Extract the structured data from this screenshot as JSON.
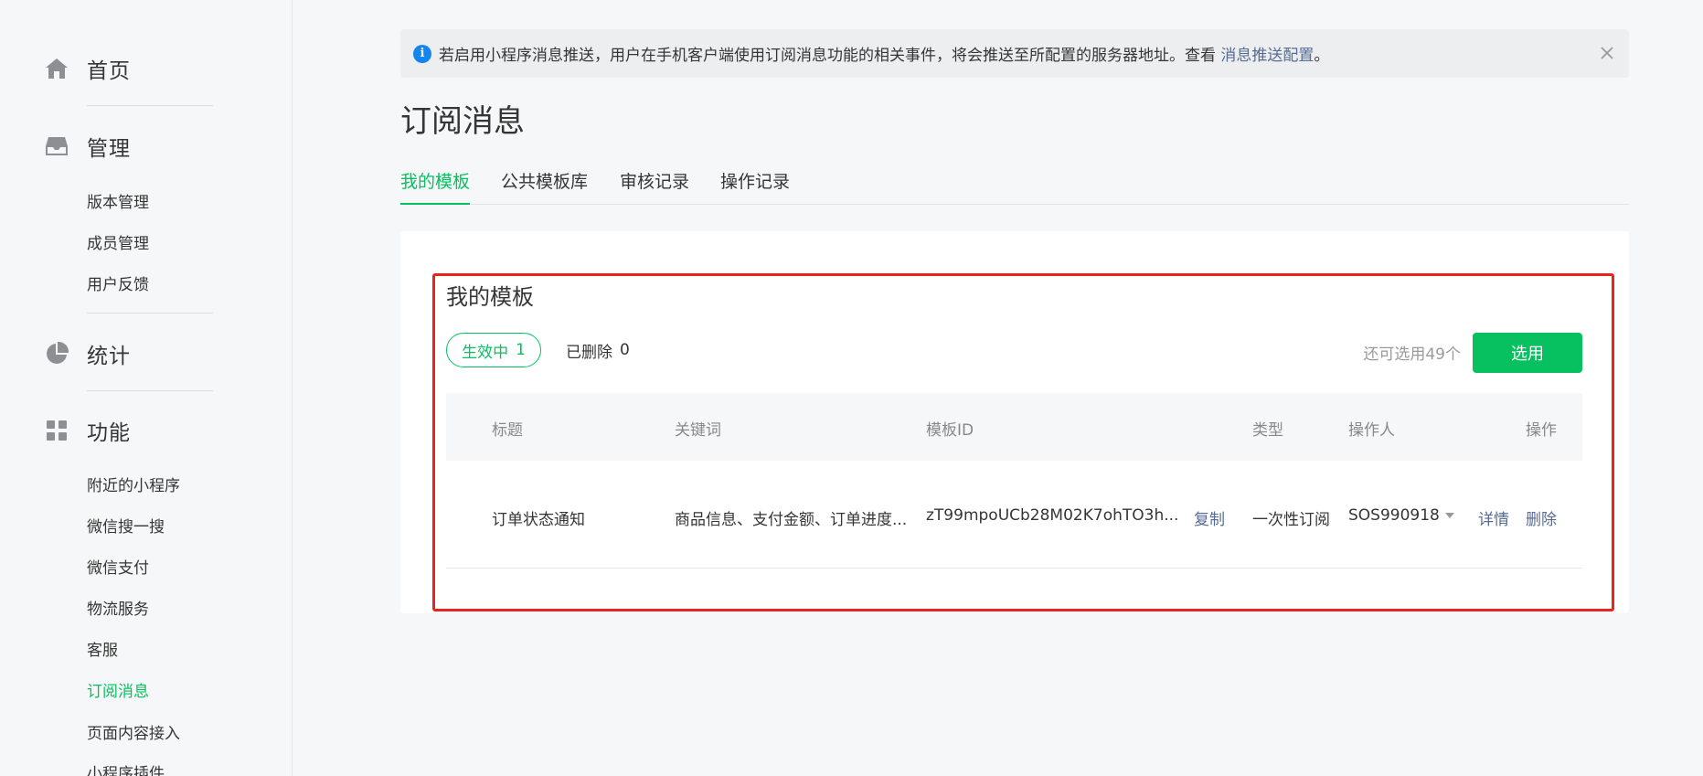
{
  "sidebar": {
    "home": "首页",
    "manage": {
      "label": "管理",
      "items": [
        "版本管理",
        "成员管理",
        "用户反馈"
      ]
    },
    "stats": "统计",
    "features": {
      "label": "功能",
      "items": [
        "附近的小程序",
        "微信搜一搜",
        "微信支付",
        "物流服务",
        "客服",
        "订阅消息",
        "页面内容接入",
        "小程序插件"
      ]
    }
  },
  "notice": {
    "text": "若启用小程序消息推送，用户在手机客户端使用订阅消息功能的相关事件，将会推送至所配置的服务器地址。查看 ",
    "link": "消息推送配置",
    "suffix": "。"
  },
  "page": {
    "title": "订阅消息"
  },
  "tabs": [
    "我的模板",
    "公共模板库",
    "审核记录",
    "操作记录"
  ],
  "card": {
    "title": "我的模板",
    "filter_active": {
      "label": "生效中",
      "count": "1"
    },
    "filter_deleted": {
      "label": "已删除",
      "count": "0"
    },
    "remaining": "还可选用49个",
    "select_button": "选用"
  },
  "table": {
    "headers": [
      "标题",
      "关键词",
      "模板ID",
      "类型",
      "操作人",
      "操作"
    ],
    "rows": [
      {
        "title": "订单状态通知",
        "keywords": "商品信息、支付金额、订单进度...",
        "template_id": "zT99mpoUCb28M02K7ohTO3h...",
        "copy": "复制",
        "type": "一次性订阅",
        "operator": "SOS990918",
        "detail": "详情",
        "delete": "删除"
      }
    ]
  },
  "colors": {
    "accent": "#07c160",
    "link": "#576b95",
    "highlight": "#e8241c",
    "info": "#1485ee"
  }
}
